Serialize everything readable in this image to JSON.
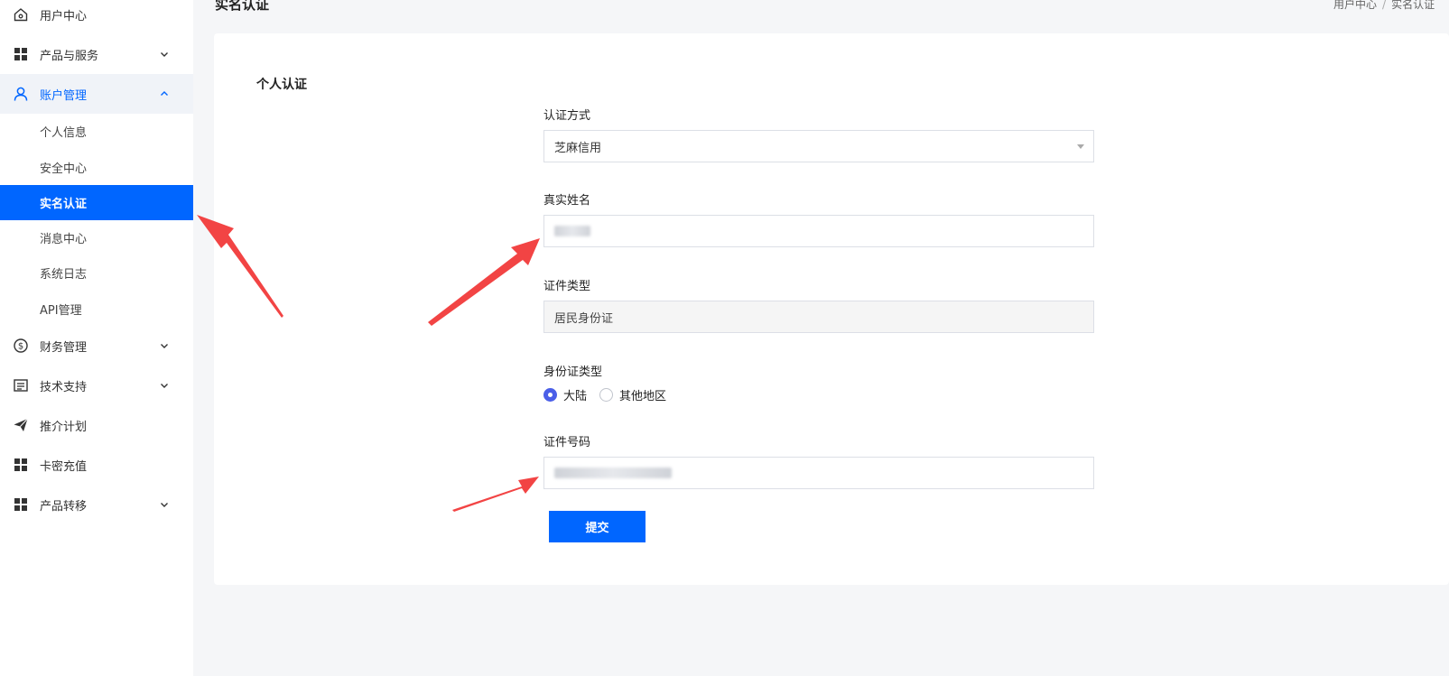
{
  "page": {
    "title": "实名认证"
  },
  "breadcrumb": {
    "home": "用户中心",
    "separator": "/",
    "current": "实名认证"
  },
  "sidebar": {
    "items": [
      {
        "label": "用户中心",
        "icon": "home-icon",
        "has_chevron": false
      },
      {
        "label": "产品与服务",
        "icon": "grid-icon",
        "has_chevron": true
      },
      {
        "label": "账户管理",
        "icon": "user-icon",
        "has_chevron": true,
        "expanded": true
      },
      {
        "label": "财务管理",
        "icon": "dollar-icon",
        "has_chevron": true
      },
      {
        "label": "技术支持",
        "icon": "document-icon",
        "has_chevron": true
      },
      {
        "label": "推介计划",
        "icon": "send-icon",
        "has_chevron": false
      },
      {
        "label": "卡密充值",
        "icon": "grid-icon",
        "has_chevron": false
      },
      {
        "label": "产品转移",
        "icon": "grid-icon",
        "has_chevron": true
      }
    ],
    "sub_items": [
      {
        "label": "个人信息"
      },
      {
        "label": "安全中心"
      },
      {
        "label": "实名认证",
        "active": true
      },
      {
        "label": "消息中心"
      },
      {
        "label": "系统日志"
      },
      {
        "label": "API管理"
      }
    ]
  },
  "form": {
    "section_title": "个人认证",
    "method_label": "认证方式",
    "method_value": "芝麻信用",
    "name_label": "真实姓名",
    "cert_type_label": "证件类型",
    "cert_type_value": "居民身份证",
    "id_type_label": "身份证类型",
    "id_type_options": [
      {
        "label": "大陆",
        "selected": true
      },
      {
        "label": "其他地区",
        "selected": false
      }
    ],
    "id_number_label": "证件号码",
    "submit_label": "提交"
  },
  "colors": {
    "primary": "#0066ff",
    "radio": "#4b5fe8",
    "arrow": "#f24444"
  }
}
